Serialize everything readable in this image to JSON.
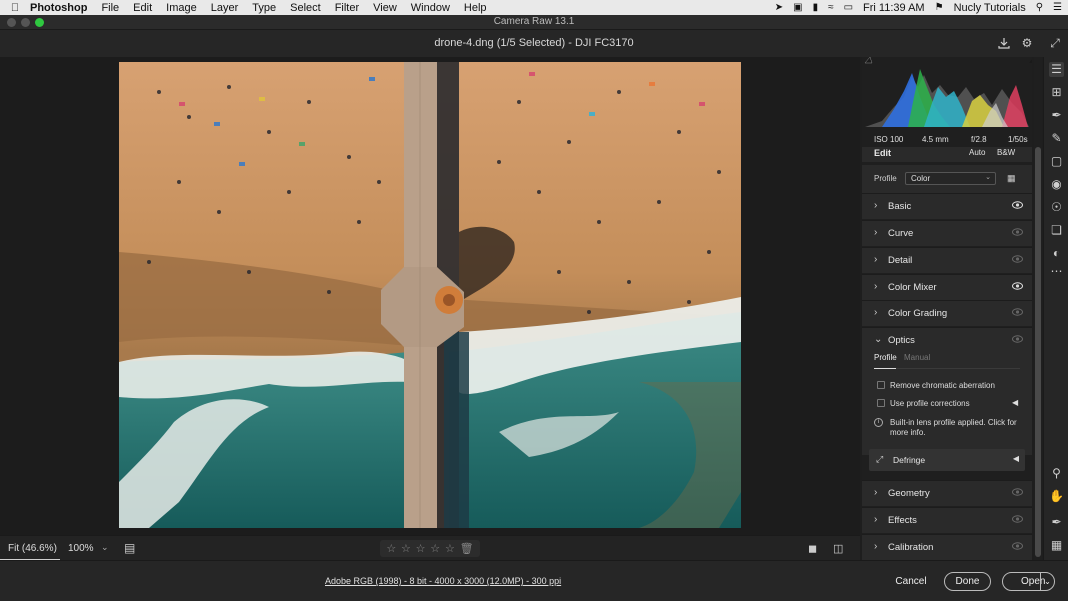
{
  "menubar": {
    "app": "Photoshop",
    "menus": [
      "File",
      "Edit",
      "Image",
      "Layer",
      "Type",
      "Select",
      "Filter",
      "View",
      "Window",
      "Help"
    ],
    "clock": "Fri 11:39 AM",
    "user": "Nucly Tutorials"
  },
  "window": {
    "title": "Camera Raw 13.1"
  },
  "header": {
    "document": "drone-4.dng (1/5 Selected)  -  DJI FC3170"
  },
  "zoom": {
    "fit_label": "Fit (46.6%)",
    "percent_label": "100%"
  },
  "rating": {
    "stars": 0,
    "max": 5
  },
  "status": {
    "info_link": "Adobe RGB (1998) - 8 bit - 4000 x 3000 (12.0MP) - 300 ppi",
    "cancel": "Cancel",
    "done": "Done",
    "open": "Open"
  },
  "exif": {
    "iso": "ISO 100",
    "focal": "4.5 mm",
    "aperture": "f/2.8",
    "shutter": "1/50s"
  },
  "edit": {
    "title": "Edit",
    "auto": "Auto",
    "bw": "B&W"
  },
  "profile": {
    "label": "Profile",
    "value": "Color"
  },
  "sections": {
    "basic": "Basic",
    "curve": "Curve",
    "detail": "Detail",
    "color_mixer": "Color Mixer",
    "color_grading": "Color Grading",
    "optics": "Optics",
    "geometry": "Geometry",
    "effects": "Effects",
    "calibration": "Calibration"
  },
  "optics": {
    "tab_profile": "Profile",
    "tab_manual": "Manual",
    "remove_ca": "Remove chromatic aberration",
    "use_profile": "Use profile corrections",
    "note": "Built-in lens profile applied.  Click for more info.",
    "defringe": "Defringe"
  },
  "colors": {
    "sand": "#c48e5a",
    "water": "#1f6e6a",
    "foam": "#e8ece8",
    "pier": "#b9a08a"
  },
  "icons": {
    "apple": "apple-icon",
    "histogram": "histogram-icon"
  }
}
